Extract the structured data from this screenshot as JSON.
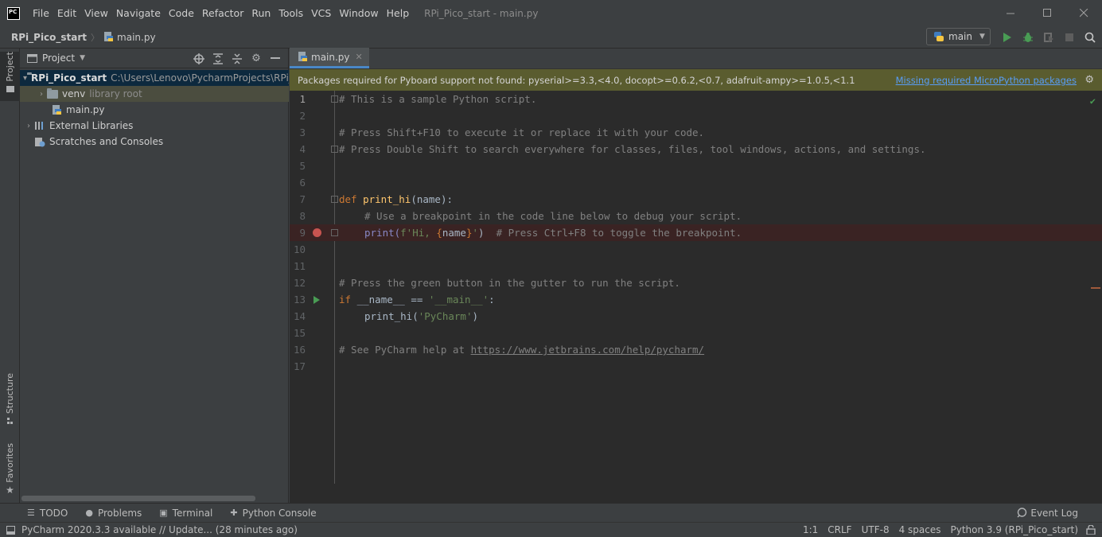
{
  "window": {
    "title": "RPi_Pico_start - main.py",
    "logo_text": "PC",
    "menu": [
      "File",
      "Edit",
      "View",
      "Navigate",
      "Code",
      "Refactor",
      "Run",
      "Tools",
      "VCS",
      "Window",
      "Help"
    ]
  },
  "navbar": {
    "project": "RPi_Pico_start",
    "file": "main.py",
    "run_config": "main"
  },
  "left_strip": {
    "project_tab": "Project",
    "structure_tab": "Structure",
    "favorites_tab": "Favorites"
  },
  "project_panel": {
    "title": "Project",
    "tree": [
      {
        "name": "RPi_Pico_start",
        "detail": "C:\\Users\\Lenovo\\PycharmProjects\\RPi_P"
      },
      {
        "name": "venv",
        "detail": "library root"
      },
      {
        "name": "main.py"
      },
      {
        "name": "External Libraries"
      },
      {
        "name": "Scratches and Consoles"
      }
    ]
  },
  "editor": {
    "tab_label": "main.py",
    "banner_text": "Packages required for Pyboard support not found: pyserial>=3.3,<4.0, docopt>=0.6.2,<0.7, adafruit-ampy>=1.0.5,<1.1",
    "banner_link": "Missing required MicroPython packages",
    "lines": {
      "l1": "# This is a sample Python script.",
      "l3": "# Press Shift+F10 to execute it or replace it with your code.",
      "l4": "# Press Double Shift to search everywhere for classes, files, tool windows, actions, and settings.",
      "l7_kw": "def",
      "l7_fn": "print_hi",
      "l7_rest": "(name):",
      "l8": "# Use a breakpoint in the code line below to debug your script.",
      "l9_a": "print(",
      "l9_str1": "f'Hi, ",
      "l9_brace1": "{",
      "l9_name": "name",
      "l9_brace2": "}",
      "l9_str2": "'",
      "l9_b": ")  ",
      "l9_comment": "# Press Ctrl+F8 to toggle the breakpoint.",
      "l12": "# Press the green button in the gutter to run the script.",
      "l13_kw": "if",
      "l13_a": " __name__ == ",
      "l13_str": "'__main__'",
      "l13_b": ":",
      "l14_a": "print_hi(",
      "l14_str": "'PyCharm'",
      "l14_b": ")",
      "l16_a": "# See PyCharm help at ",
      "l16_link": "https://www.jetbrains.com/help/pycharm/"
    },
    "line_numbers": [
      "1",
      "2",
      "3",
      "4",
      "5",
      "6",
      "7",
      "8",
      "9",
      "10",
      "11",
      "12",
      "13",
      "14",
      "15",
      "16",
      "17"
    ]
  },
  "bottom_tabs": {
    "todo": "TODO",
    "problems": "Problems",
    "terminal": "Terminal",
    "python_console": "Python Console",
    "event_log": "Event Log"
  },
  "status": {
    "message": "PyCharm 2020.3.3 available // Update... (28 minutes ago)",
    "position": "1:1",
    "line_sep": "CRLF",
    "encoding": "UTF-8",
    "indent": "4 spaces",
    "interpreter": "Python 3.9 (RPi_Pico_start)"
  },
  "colors": {
    "accent": "#4a88c7",
    "banner_bg": "#5a5c2f",
    "breakpoint": "#c75450",
    "run_green": "#499c54"
  }
}
